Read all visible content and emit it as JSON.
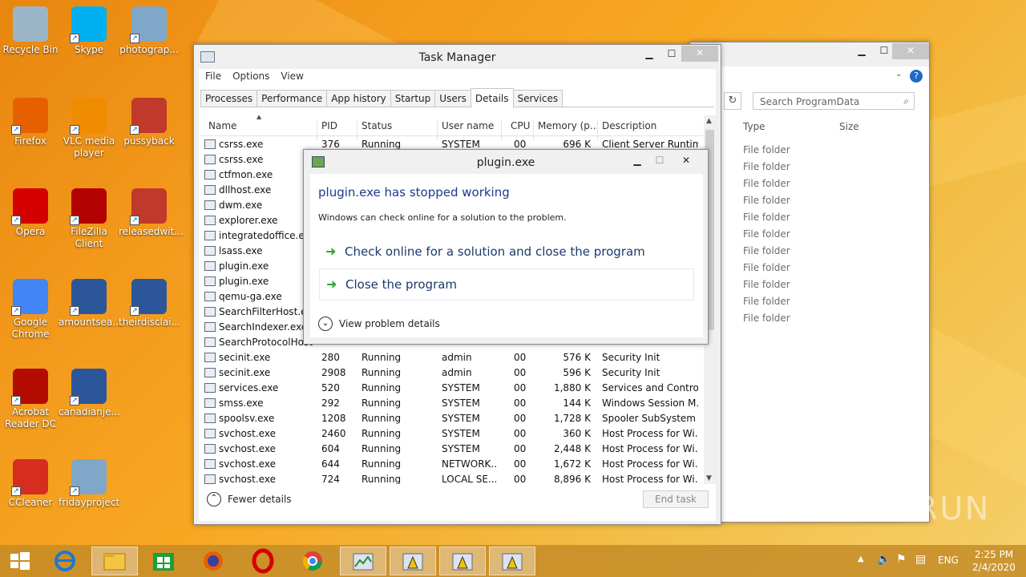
{
  "desktop": {
    "icons": [
      {
        "label": "Recycle Bin"
      },
      {
        "label": "Skype"
      },
      {
        "label": "photograp..."
      },
      {
        "label": "Firefox"
      },
      {
        "label": "VLC media player"
      },
      {
        "label": "pussyback"
      },
      {
        "label": "Opera"
      },
      {
        "label": "FileZilla Client"
      },
      {
        "label": "releasedwit..."
      },
      {
        "label": "Google Chrome"
      },
      {
        "label": "amountsea..."
      },
      {
        "label": "theirdisclai..."
      },
      {
        "label": "Acrobat Reader DC"
      },
      {
        "label": "canadianje..."
      },
      {
        "label": "CCleaner"
      },
      {
        "label": "fridayproject"
      }
    ]
  },
  "explorer": {
    "search_placeholder": "Search ProgramData",
    "col_type": "Type",
    "col_size": "Size",
    "rows": [
      "File folder",
      "File folder",
      "File folder",
      "File folder",
      "File folder",
      "File folder",
      "File folder",
      "File folder",
      "File folder",
      "File folder",
      "File folder"
    ]
  },
  "taskmgr": {
    "title": "Task Manager",
    "menu": [
      "File",
      "Options",
      "View"
    ],
    "tabs": [
      "Processes",
      "Performance",
      "App history",
      "Startup",
      "Users",
      "Details",
      "Services"
    ],
    "active_tab": "Details",
    "columns": {
      "name": "Name",
      "pid": "PID",
      "status": "Status",
      "user": "User name",
      "cpu": "CPU",
      "memory": "Memory (p...",
      "description": "Description"
    },
    "rows": [
      {
        "name": "csrss.exe",
        "pid": "376",
        "status": "Running",
        "user": "SYSTEM",
        "cpu": "00",
        "memory": "696 K",
        "description": "Client Server Runtim..."
      },
      {
        "name": "csrss.exe",
        "pid": "",
        "status": "",
        "user": "",
        "cpu": "",
        "memory": "",
        "description": ""
      },
      {
        "name": "ctfmon.exe",
        "pid": "",
        "status": "",
        "user": "",
        "cpu": "",
        "memory": "",
        "description": ""
      },
      {
        "name": "dllhost.exe",
        "pid": "",
        "status": "",
        "user": "",
        "cpu": "",
        "memory": "",
        "description": ""
      },
      {
        "name": "dwm.exe",
        "pid": "",
        "status": "",
        "user": "",
        "cpu": "",
        "memory": "",
        "description": ""
      },
      {
        "name": "explorer.exe",
        "pid": "",
        "status": "",
        "user": "",
        "cpu": "",
        "memory": "",
        "description": ""
      },
      {
        "name": "integratedoffice.exe",
        "pid": "",
        "status": "",
        "user": "",
        "cpu": "",
        "memory": "",
        "description": ""
      },
      {
        "name": "lsass.exe",
        "pid": "",
        "status": "",
        "user": "",
        "cpu": "",
        "memory": "",
        "description": ""
      },
      {
        "name": "plugin.exe",
        "pid": "",
        "status": "",
        "user": "",
        "cpu": "",
        "memory": "",
        "description": ""
      },
      {
        "name": "plugin.exe",
        "pid": "",
        "status": "",
        "user": "",
        "cpu": "",
        "memory": "",
        "description": ""
      },
      {
        "name": "qemu-ga.exe",
        "pid": "",
        "status": "",
        "user": "",
        "cpu": "",
        "memory": "",
        "description": ""
      },
      {
        "name": "SearchFilterHost.exe",
        "pid": "",
        "status": "",
        "user": "",
        "cpu": "",
        "memory": "",
        "description": ""
      },
      {
        "name": "SearchIndexer.exe",
        "pid": "",
        "status": "",
        "user": "",
        "cpu": "",
        "memory": "",
        "description": ""
      },
      {
        "name": "SearchProtocolHost",
        "pid": "",
        "status": "",
        "user": "",
        "cpu": "",
        "memory": "",
        "description": ""
      },
      {
        "name": "secinit.exe",
        "pid": "280",
        "status": "Running",
        "user": "admin",
        "cpu": "00",
        "memory": "576 K",
        "description": "Security Init"
      },
      {
        "name": "secinit.exe",
        "pid": "2908",
        "status": "Running",
        "user": "admin",
        "cpu": "00",
        "memory": "596 K",
        "description": "Security Init"
      },
      {
        "name": "services.exe",
        "pid": "520",
        "status": "Running",
        "user": "SYSTEM",
        "cpu": "00",
        "memory": "1,880 K",
        "description": "Services and Control..."
      },
      {
        "name": "smss.exe",
        "pid": "292",
        "status": "Running",
        "user": "SYSTEM",
        "cpu": "00",
        "memory": "144 K",
        "description": "Windows Session M..."
      },
      {
        "name": "spoolsv.exe",
        "pid": "1208",
        "status": "Running",
        "user": "SYSTEM",
        "cpu": "00",
        "memory": "1,728 K",
        "description": "Spooler SubSystem ..."
      },
      {
        "name": "svchost.exe",
        "pid": "2460",
        "status": "Running",
        "user": "SYSTEM",
        "cpu": "00",
        "memory": "360 K",
        "description": "Host Process for Wi..."
      },
      {
        "name": "svchost.exe",
        "pid": "604",
        "status": "Running",
        "user": "SYSTEM",
        "cpu": "00",
        "memory": "2,448 K",
        "description": "Host Process for Wi..."
      },
      {
        "name": "svchost.exe",
        "pid": "644",
        "status": "Running",
        "user": "NETWORK...",
        "cpu": "00",
        "memory": "1,672 K",
        "description": "Host Process for Wi..."
      },
      {
        "name": "svchost.exe",
        "pid": "724",
        "status": "Running",
        "user": "LOCAL SE...",
        "cpu": "00",
        "memory": "8,896 K",
        "description": "Host Process for Wi..."
      }
    ],
    "fewer_details": "Fewer details",
    "end_task": "End task"
  },
  "dialog": {
    "title": "plugin.exe",
    "heading": "plugin.exe has stopped working",
    "message": "Windows can check online for a solution to the problem.",
    "option_check": "Check online for a solution and close the program",
    "option_close": "Close the program",
    "view_details": "View problem details"
  },
  "tray": {
    "lang": "ENG",
    "time": "2:25 PM",
    "date": "2/4/2020"
  },
  "watermark": "ANY RUN"
}
